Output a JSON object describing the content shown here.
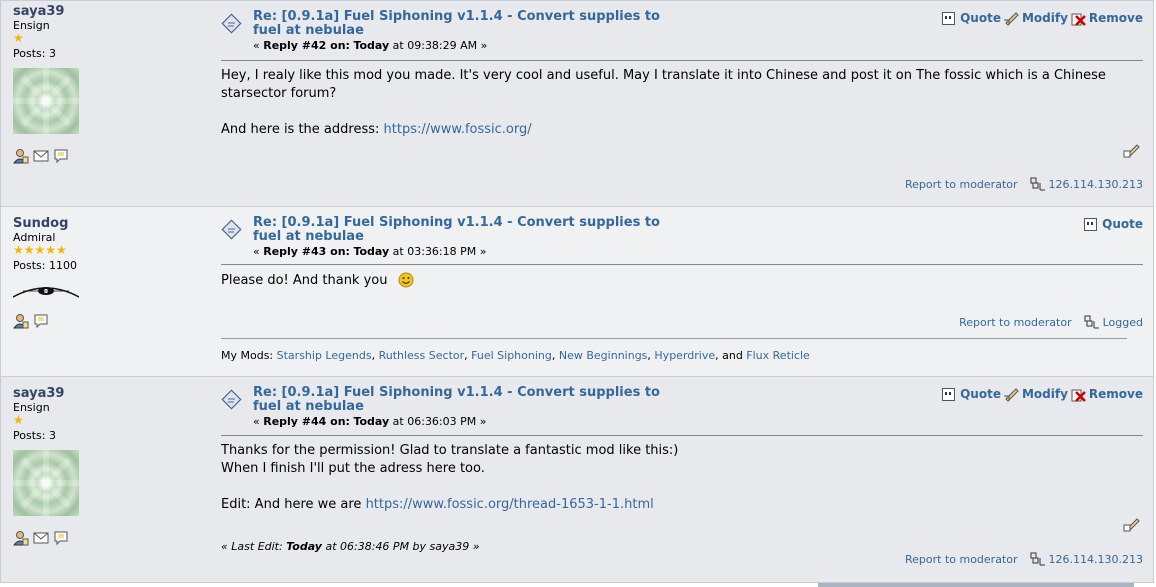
{
  "posts": [
    {
      "author": "saya39",
      "rank": "Ensign",
      "stars": "★",
      "posts_label": "Posts: 3",
      "subject_line1": "Re: [0.9.1a] Fuel Siphoning v1.1.4 - Convert supplies to",
      "subject_line2": "fuel at nebulae",
      "reply_prefix": "« ",
      "reply_label": "Reply #42 on:",
      "today": "Today",
      "time": " at 09:38:29 AM »",
      "actions": [
        "Quote",
        "Modify",
        "Remove"
      ],
      "body_line1": "Hey, I realy like this mod you made. It's very cool and useful. May I translate it into Chinese and post it on The fossic which is a Chinese",
      "body_line2": "starsector forum?",
      "body_line3": "And here is the address: ",
      "body_link": "https://www.fossic.org/",
      "report": "Report to moderator",
      "ip": "126.114.130.213"
    },
    {
      "author": "Sundog",
      "rank": "Admiral",
      "stars": "★★★★★",
      "posts_label": "Posts: 1100",
      "subject_line1": "Re: [0.9.1a] Fuel Siphoning v1.1.4 - Convert supplies to",
      "subject_line2": "fuel at nebulae",
      "reply_prefix": "« ",
      "reply_label": "Reply #43 on:",
      "today": "Today",
      "time": " at 03:36:18 PM »",
      "actions": [
        "Quote"
      ],
      "body_line1": "Please do! And thank you",
      "report": "Report to moderator",
      "ip": "Logged",
      "sig_prefix": "My Mods: ",
      "sig_mods": [
        "Starship Legends",
        "Ruthless Sector",
        "Fuel Siphoning",
        "New Beginnings",
        "Hyperdrive",
        "Flux Reticle"
      ],
      "sig_sep": ", ",
      "sig_and": ", and "
    },
    {
      "author": "saya39",
      "rank": "Ensign",
      "stars": "★",
      "posts_label": "Posts: 3",
      "subject_line1": "Re: [0.9.1a] Fuel Siphoning v1.1.4 - Convert supplies to",
      "subject_line2": "fuel at nebulae",
      "reply_prefix": "« ",
      "reply_label": "Reply #44 on:",
      "today": "Today",
      "time": " at 06:36:03 PM »",
      "actions": [
        "Quote",
        "Modify",
        "Remove"
      ],
      "body_line1": "Thanks for the permission! Glad to translate a fantastic mod like this:)",
      "body_line2": "When I finish I'll put the adress here too.",
      "body_line3": "Edit: And here we are ",
      "body_link": "https://www.fossic.org/thread-1653-1-1.html",
      "last_edit_prefix": "« Last Edit: ",
      "last_edit_today": "Today",
      "last_edit_rest": " at 06:38:46 PM by saya39 »",
      "report": "Report to moderator",
      "ip": "126.114.130.213"
    }
  ],
  "colors": {
    "link": "#34689c",
    "alt_bg": "#e8e9ec",
    "star": "#f0b800"
  }
}
